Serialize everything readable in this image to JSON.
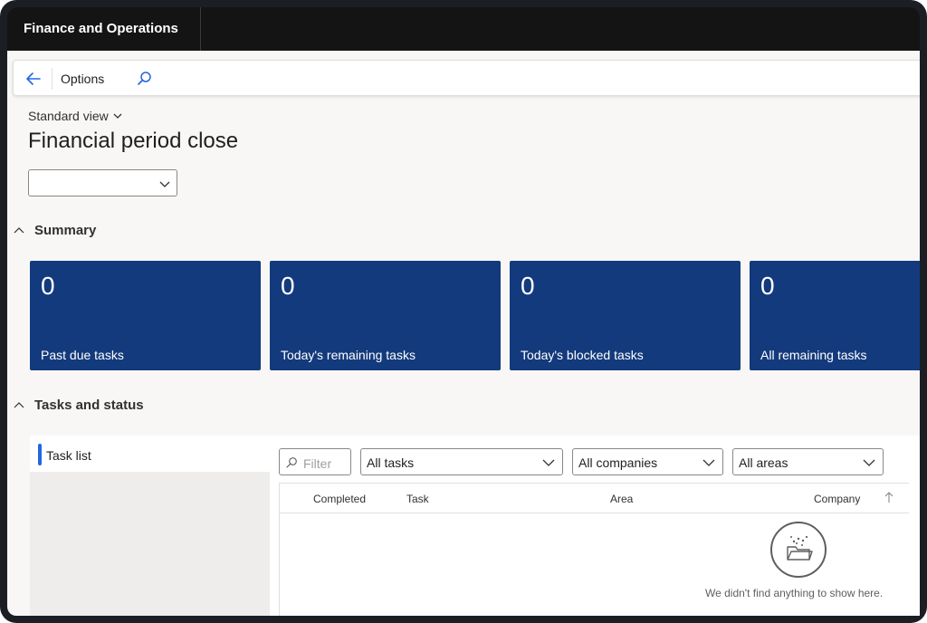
{
  "app": {
    "title": "Finance and Operations"
  },
  "actionbar": {
    "options_label": "Options"
  },
  "page": {
    "view_selector": "Standard view",
    "title": "Financial period close",
    "period_value": ""
  },
  "summary": {
    "label": "Summary",
    "tiles": [
      {
        "count": "0",
        "label": "Past due tasks"
      },
      {
        "count": "0",
        "label": "Today's remaining tasks"
      },
      {
        "count": "0",
        "label": "Today's blocked tasks"
      },
      {
        "count": "0",
        "label": "All remaining tasks"
      }
    ]
  },
  "tasks": {
    "label": "Tasks and status",
    "nav_item": "Task list",
    "filter_placeholder": "Filter",
    "task_filter": "All tasks",
    "company_filter": "All companies",
    "area_filter": "All areas",
    "columns": [
      "Completed",
      "Task",
      "Area",
      "Company"
    ],
    "empty_message": "We didn't find anything to show here."
  },
  "colors": {
    "tile": "#133a7c",
    "accent": "#2266e3",
    "appbar": "#141414"
  },
  "icons": [
    "back-arrow-icon",
    "search-icon",
    "chevron-down-icon",
    "chevron-up-icon",
    "sort-arrow-icon",
    "empty-folder-icon"
  ]
}
